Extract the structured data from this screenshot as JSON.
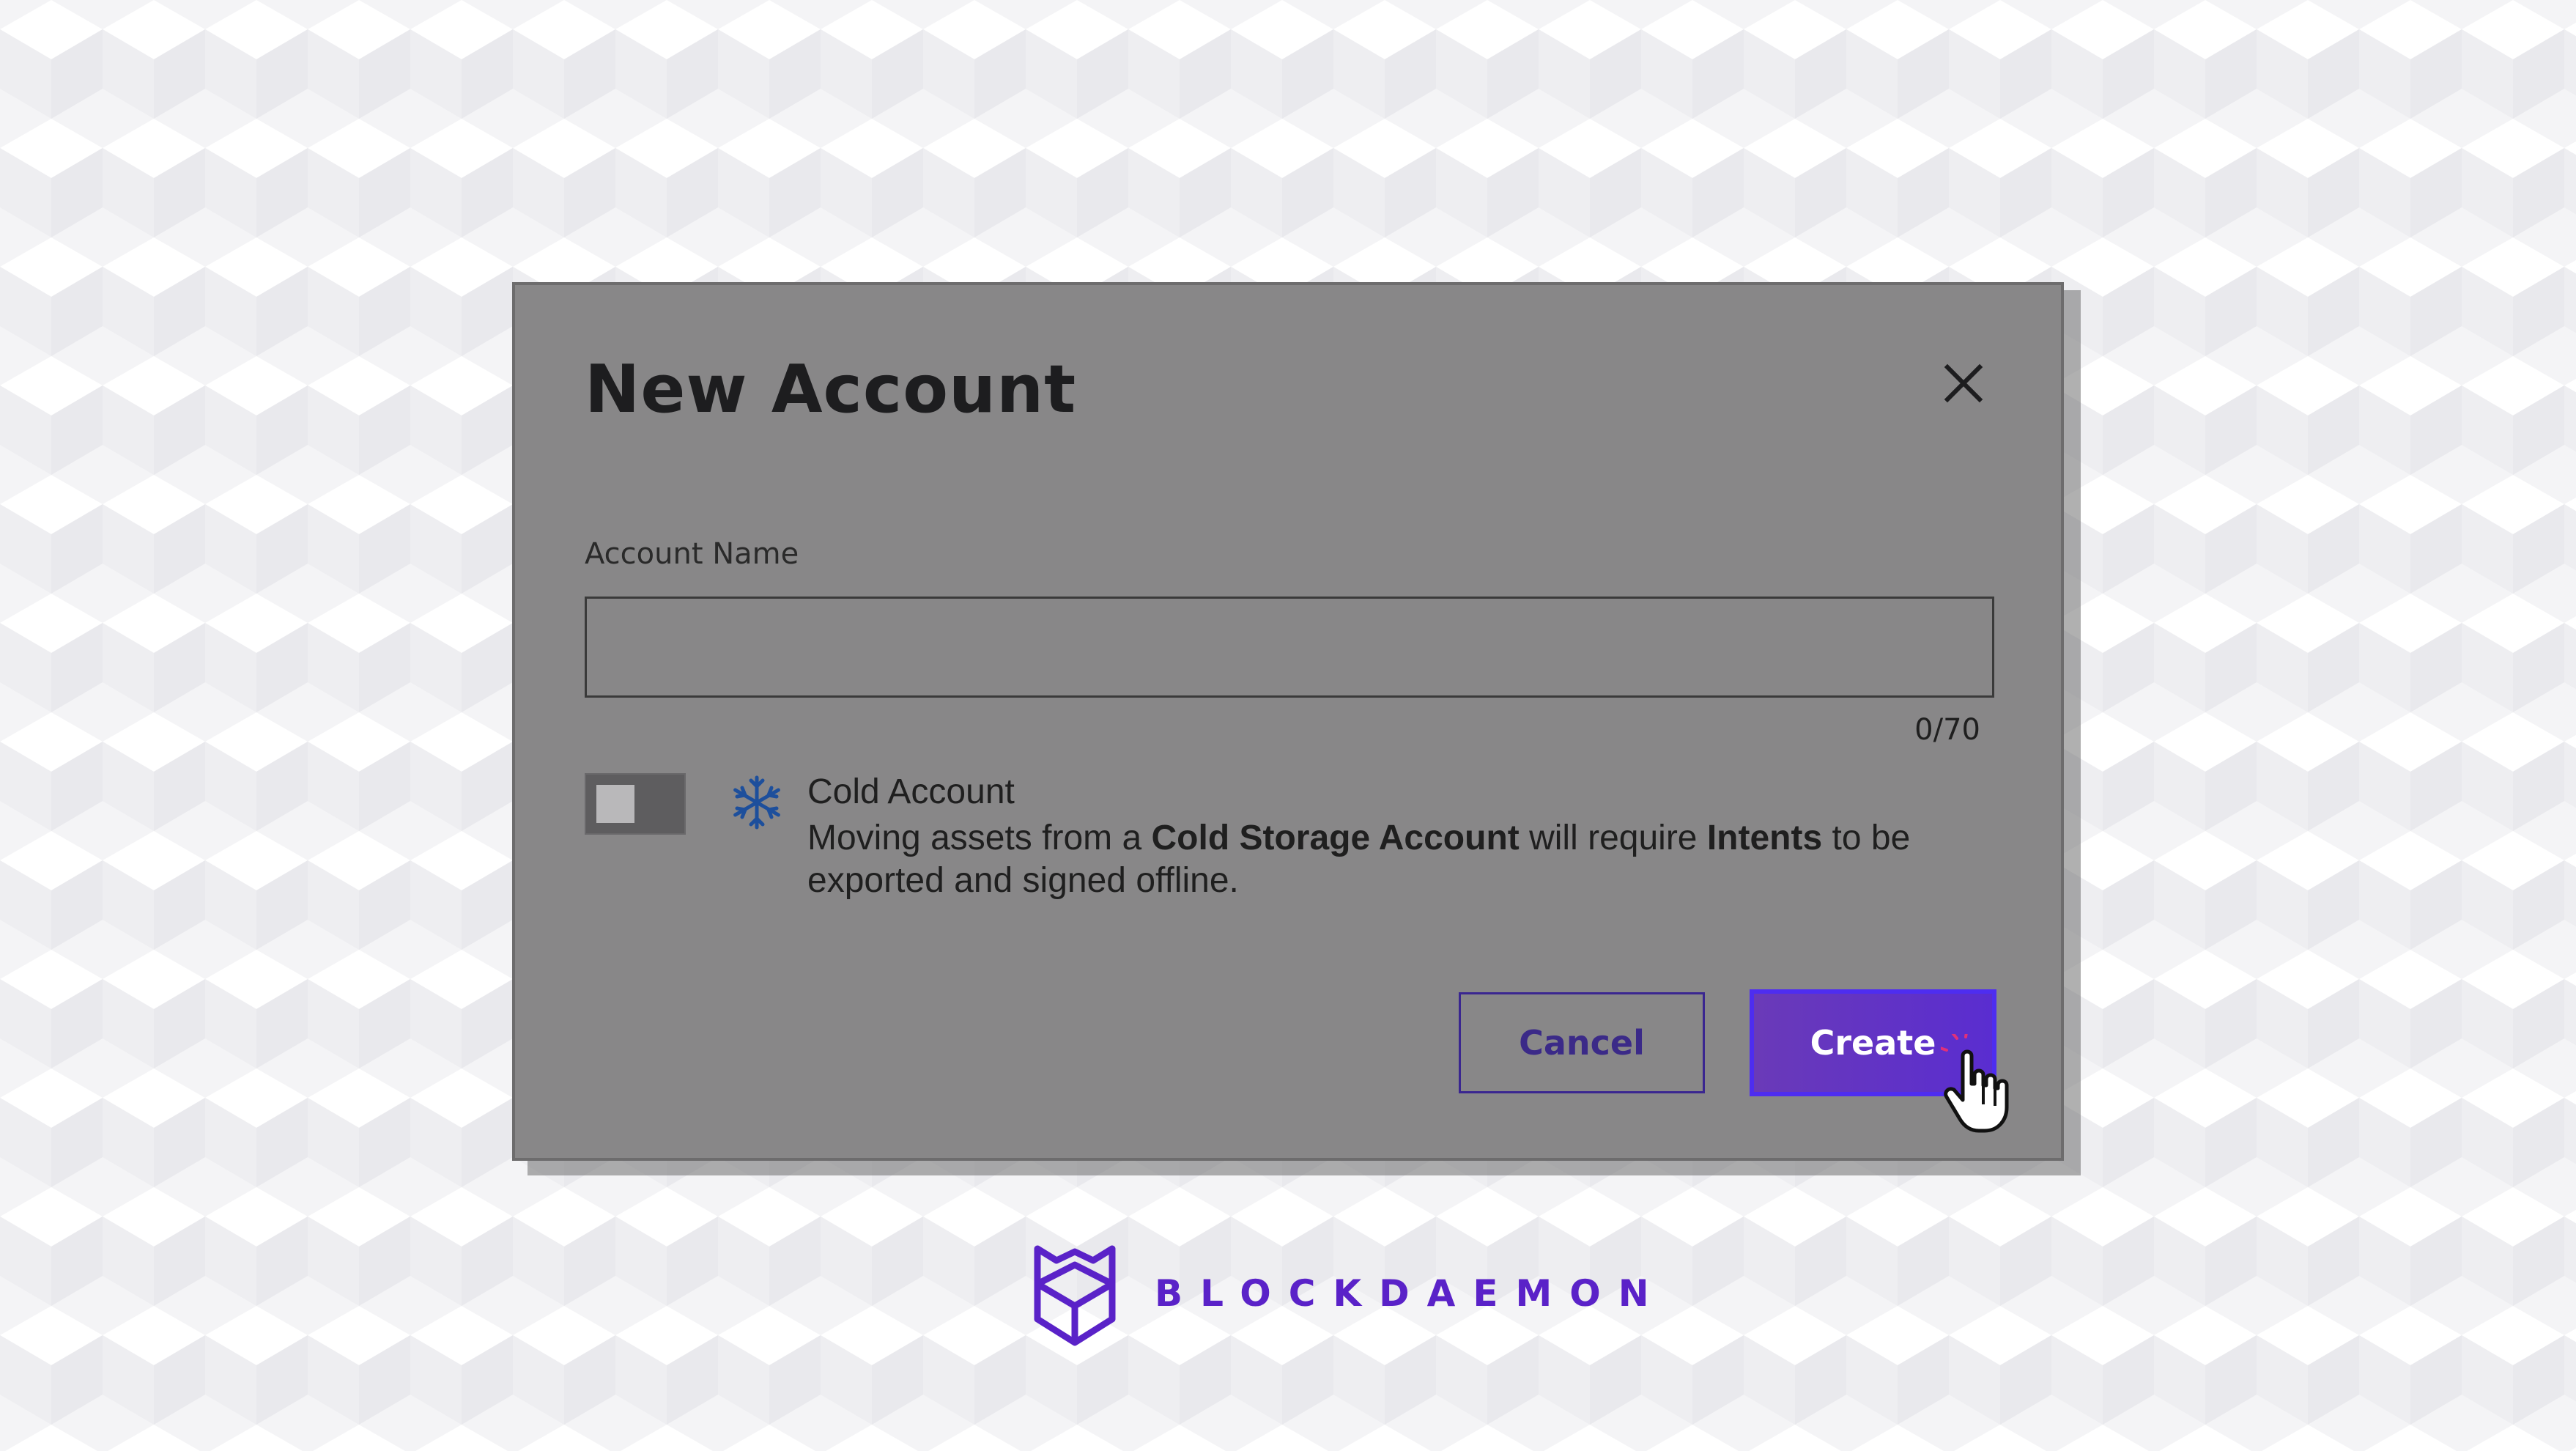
{
  "modal": {
    "title": "New Account",
    "account_name_label": "Account Name",
    "account_name_value": "",
    "char_count": "0/70",
    "cold_account": {
      "title": "Cold Account",
      "desc_part1": "Moving assets from a ",
      "desc_bold1": "Cold Storage Account",
      "desc_part2": " will require ",
      "desc_bold2": "Intents",
      "desc_part3": " to be exported and signed offline.",
      "toggle_on": false
    },
    "cancel_label": "Cancel",
    "create_label": "Create"
  },
  "brand": {
    "name": "BLOCKDAEMON"
  },
  "colors": {
    "accent": "#5a22c8",
    "create_button_border": "#4e2df0",
    "modal_bg": "#888788",
    "snowflake": "#1d4f9c"
  },
  "icons": {
    "close": "close-icon",
    "snowflake": "snowflake-icon",
    "cursor": "hand-pointer-icon",
    "logo": "blockdaemon-logo"
  }
}
